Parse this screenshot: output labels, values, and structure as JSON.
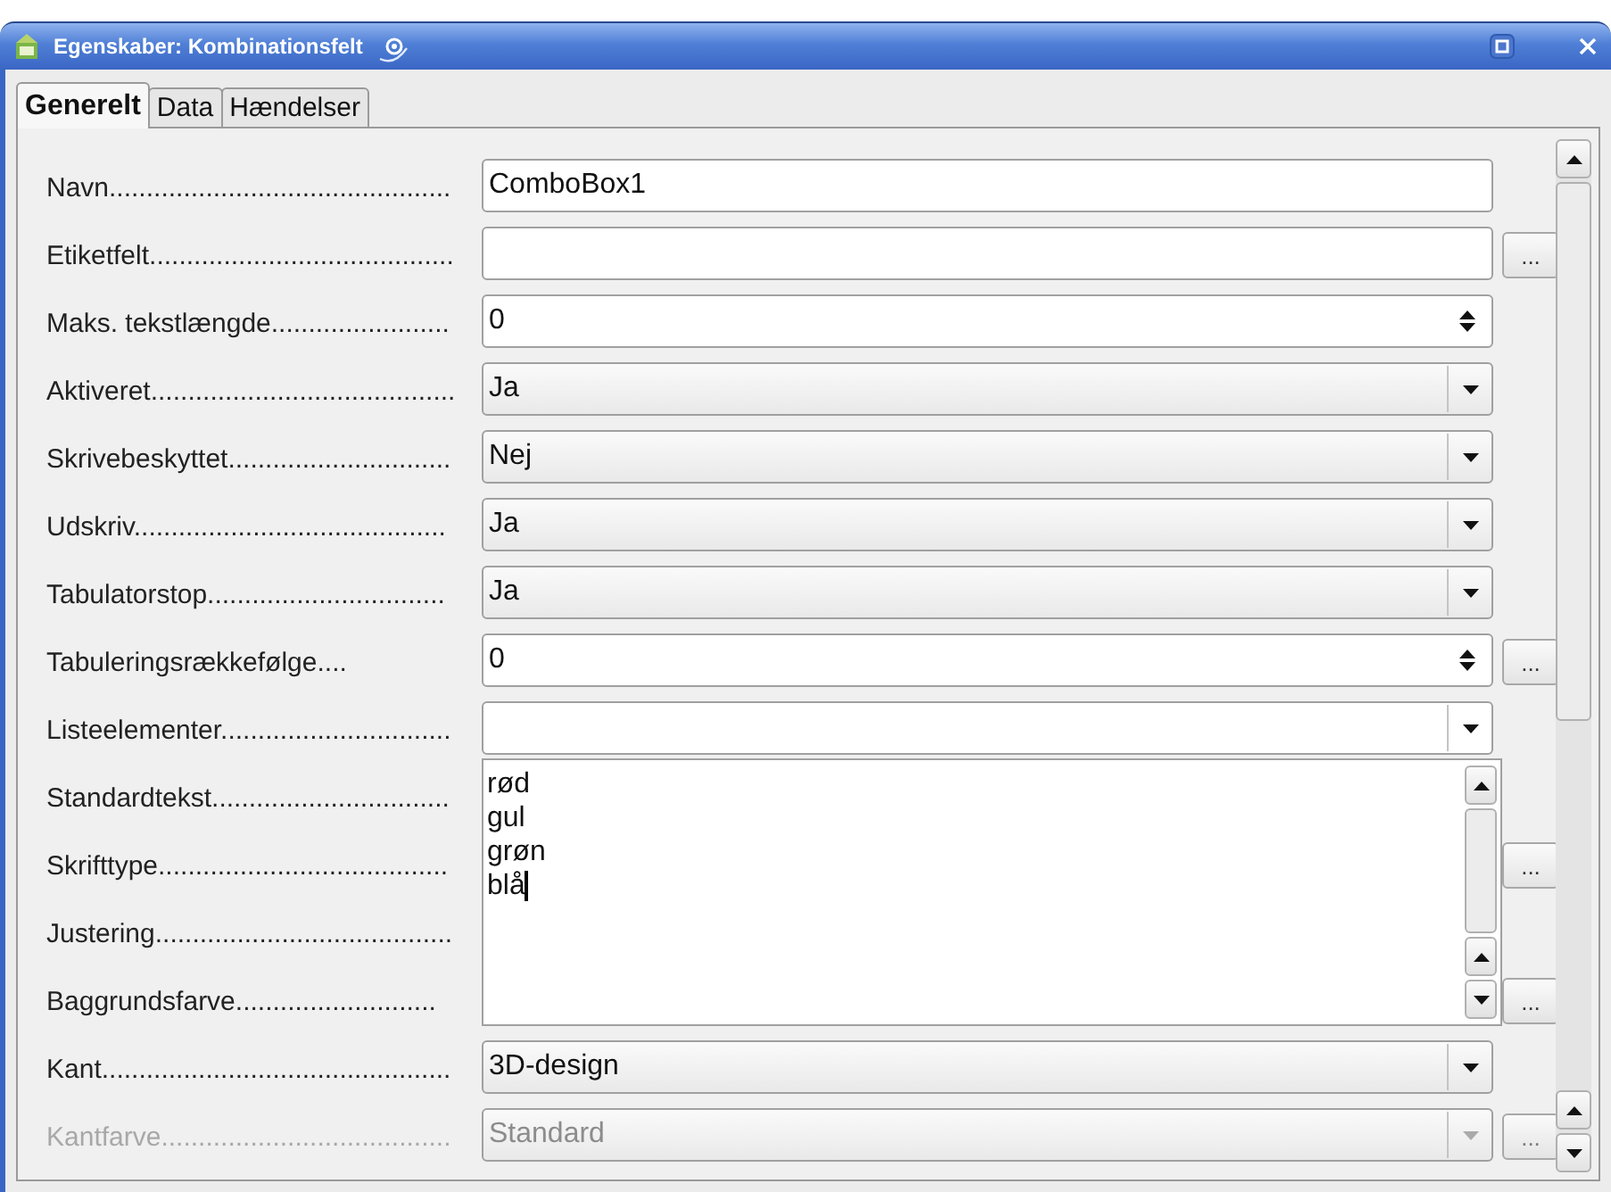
{
  "window": {
    "title": "Egenskaber: Kombinationsfelt"
  },
  "tabs": [
    {
      "label": "Generelt",
      "selected": true
    },
    {
      "label": "Data",
      "selected": false
    },
    {
      "label": "Hændelser",
      "selected": false
    }
  ],
  "rows": [
    {
      "label": "Navn..............................................",
      "kind": "text",
      "value": "ComboBox1"
    },
    {
      "label": "Etiketfelt.........................................",
      "kind": "text",
      "more_button": "..."
    },
    {
      "label": "Maks. tekstlængde........................",
      "kind": "spin",
      "value": "0"
    },
    {
      "label": "Aktiveret.........................................",
      "kind": "select",
      "value": "Ja"
    },
    {
      "label": "Skrivebeskyttet..............................",
      "kind": "select",
      "value": "Nej"
    },
    {
      "label": "Udskriv..........................................",
      "kind": "select",
      "value": "Ja"
    },
    {
      "label": "Tabulatorstop................................",
      "kind": "select",
      "value": "Ja"
    },
    {
      "label": "Tabuleringsrækkefølge....",
      "kind": "spin",
      "value": "0",
      "more_button": "..."
    },
    {
      "label": "Listeelementer...............................",
      "kind": "select",
      "popup_lines": [
        "rød",
        "gul",
        "grøn",
        "blå"
      ]
    },
    {
      "label": "Standardtekst................................",
      "kind": "covered"
    },
    {
      "label": "Skrifttype.......................................",
      "kind": "covered",
      "more_button": "..."
    },
    {
      "label": "Justering........................................",
      "kind": "covered"
    },
    {
      "label": "Baggrundsfarve...........................",
      "kind": "covered",
      "more_button": "..."
    },
    {
      "label": "Kant...............................................",
      "kind": "select",
      "value": "3D-design"
    },
    {
      "label": "Kantfarve.......................................",
      "kind": "select",
      "value": "Standard",
      "more_button": "...",
      "disabled": true
    }
  ]
}
